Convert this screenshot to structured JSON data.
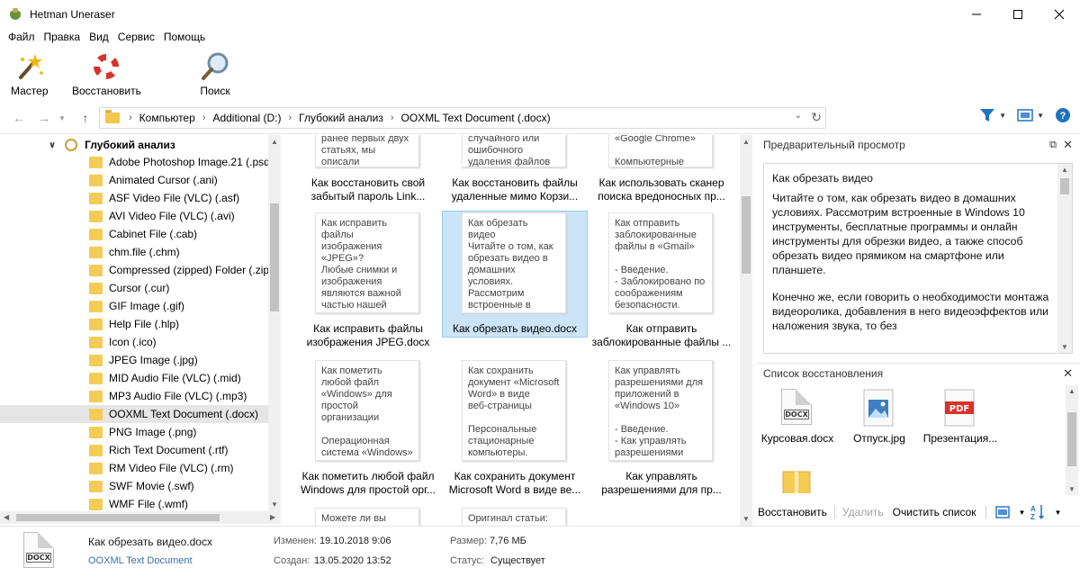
{
  "window": {
    "title": "Hetman Uneraser"
  },
  "menu": [
    "Файл",
    "Правка",
    "Вид",
    "Сервис",
    "Помощь"
  ],
  "toolbar": {
    "wizard_label": "Мастер",
    "restore_label": "Восстановить",
    "search_label": "Поиск"
  },
  "breadcrumb": [
    "Компьютер",
    "Additional (D:)",
    "Глубокий анализ",
    "OOXML Text Document (.docx)"
  ],
  "tree": {
    "root_label": "Глубокий анализ",
    "items": [
      "Adobe Photoshop Image.21 (.psd)",
      "Animated Cursor (.ani)",
      "ASF Video File (VLC) (.asf)",
      "AVI Video File (VLC) (.avi)",
      "Cabinet File (.cab)",
      "chm.file (.chm)",
      "Compressed (zipped) Folder (.zip)",
      "Cursor (.cur)",
      "GIF Image (.gif)",
      "Help File (.hlp)",
      "Icon (.ico)",
      "JPEG Image (.jpg)",
      "MID Audio File (VLC) (.mid)",
      "MP3 Audio File (VLC) (.mp3)",
      "OOXML Text Document (.docx)",
      "PNG Image (.png)",
      "Rich Text Document (.rtf)",
      "RM Video File (VLC) (.rm)",
      "SWF Movie (.swf)",
      "WMF File (.wmf)"
    ],
    "selected_index": 14
  },
  "grid": {
    "tiles": [
      {
        "preview": "ранее первых двух\nстатьях, мы\nописали возможные",
        "caption": "Как восстановить свой забытый пароль Link..."
      },
      {
        "preview": "случайного или\nошибочного\nудаления файлов",
        "caption": "Как восстановить файлы удаленные мимо Корзи..."
      },
      {
        "preview": "«Google Chrome»\n\nКомпьютерные",
        "caption": "Как использовать сканер поиска вредоносных пр..."
      },
      {
        "preview": "Как исправить\nфайлы\nизображения\n«JPEG»?\nЛюбые снимки и\nизображения\nявляются важной\nчастью нашей",
        "caption": "Как исправить файлы изображения JPEG.docx"
      },
      {
        "preview": "Как обрезать\nвидео\nЧитайте о том, как\nобрезать видео в\nдомашних\nусловиях.\nРассмотрим\nвстроенные в",
        "caption": "Как обрезать видео.docx"
      },
      {
        "preview": "Как отправить\nзаблокированные\nфайлы в «Gmail»\n\n- Введение.\n- Заблокировано по\nсоображениям\nбезопасности.",
        "caption": "Как отправить заблокированные файлы ..."
      },
      {
        "preview": "Как пометить\nлюбой файл\n«Windows» для\nпростой\nорганизации\n\nОперационная\nсистема «Windows»",
        "caption": "Как пометить любой файл Windows для простой орг..."
      },
      {
        "preview": "Как сохранить\nдокумент «Microsoft\nWord» в виде\nвеб-страницы\n\nПерсональные\nстационарные\nкомпьютеры.",
        "caption": "Как сохранить документ Microsoft Word в виде ве..."
      },
      {
        "preview": "Как управлять\nразрешениями для\nприложений в\n«Windows 10»\n\n- Введение.\n- Как управлять\nразрешениями",
        "caption": "Как управлять разрешениями для пр..."
      },
      {
        "preview": "Можете ли вы",
        "caption": ""
      },
      {
        "preview": "Оригинал статьи:",
        "caption": ""
      }
    ],
    "selected_index": 4
  },
  "preview": {
    "header": "Предварительный просмотр",
    "title": "Как обрезать видео",
    "para1": "Читайте о том, как обрезать видео в домашних условиях. Рассмотрим встроенные в Windows 10 инструменты, бесплатные программы и онлайн инструменты для обрезки видео, а также способ обрезать видео прямиком на смартфоне или планшете.",
    "para2": "Конечно же, если говорить о необходимости монтажа видеоролика, добавления в него видеоэффектов или наложения звука, то без"
  },
  "recovery": {
    "header": "Список восстановления",
    "items": [
      {
        "name": "Курсовая.docx",
        "icon": "docx-file-icon",
        "badge": "DOCX"
      },
      {
        "name": "Отпуск.jpg",
        "icon": "image-file-icon"
      },
      {
        "name": "Презентация...",
        "icon": "pdf-file-icon",
        "badge": "PDF"
      },
      {
        "name": "",
        "icon": "zip-file-icon"
      }
    ],
    "restore_label": "Восстановить",
    "delete_label": "Удалить",
    "clear_label": "Очистить список"
  },
  "status": {
    "file_name": "Как обрезать видео.docx",
    "file_type": "OOXML Text Document",
    "modified_label": "Изменен:",
    "modified_value": "19.10.2018 9:06",
    "created_label": "Создан:",
    "created_value": "13.05.2020 13:52",
    "size_label": "Размер:",
    "size_value": "7,76 МБ",
    "status_label": "Статус:",
    "status_value": "Существует",
    "icon_badge": "DOCX"
  },
  "colors": {
    "selection": "#cce4f7",
    "folder": "#f5cb56",
    "accent_blue": "#1e73be",
    "restore_red": "#d9322a"
  }
}
